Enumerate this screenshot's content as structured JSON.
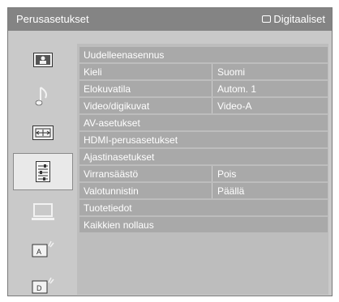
{
  "header": {
    "title": "Perusasetukset",
    "source_label": "Digitaaliset",
    "source_icon": "tv-screen-icon"
  },
  "sidebar": {
    "items": [
      {
        "icon": "picture-icon"
      },
      {
        "icon": "music-note-icon"
      },
      {
        "icon": "screen-format-icon"
      },
      {
        "icon": "settings-list-icon",
        "selected": true
      },
      {
        "icon": "monitor-icon"
      },
      {
        "icon": "analog-antenna-icon"
      },
      {
        "icon": "digital-antenna-icon"
      }
    ]
  },
  "menu": {
    "rows": [
      {
        "label": "Uudelleenasennus",
        "value": ""
      },
      {
        "label": "Kieli",
        "value": "Suomi"
      },
      {
        "label": "Elokuvatila",
        "value": "Autom. 1"
      },
      {
        "label": "Video/digikuvat",
        "value": "Video-A"
      },
      {
        "label": "AV-asetukset",
        "value": ""
      },
      {
        "label": "HDMI-perusasetukset",
        "value": ""
      },
      {
        "label": "Ajastinasetukset",
        "value": ""
      },
      {
        "label": "Virransäästö",
        "value": "Pois"
      },
      {
        "label": "Valotunnistin",
        "value": "Päällä"
      },
      {
        "label": "Tuotetiedot",
        "value": ""
      },
      {
        "label": "Kaikkien nollaus",
        "value": ""
      }
    ]
  }
}
